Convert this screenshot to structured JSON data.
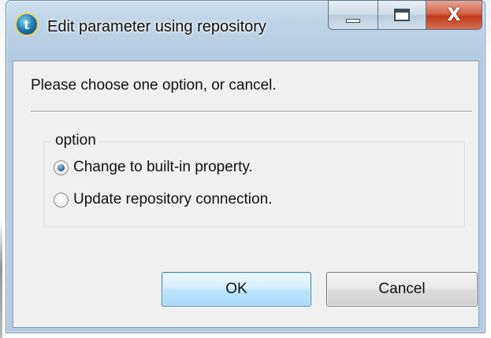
{
  "window": {
    "title": "Edit parameter using repository",
    "icon": "talend-app-icon",
    "icon_glyph": "t",
    "controls": {
      "minimize_icon": "minimize-icon",
      "maximize_icon": "maximize-icon",
      "close_icon": "close-icon",
      "close_glyph": "X"
    }
  },
  "dialog": {
    "prompt": "Please choose one option, or cancel.",
    "group": {
      "label": "option",
      "options": [
        {
          "label": "Change to built-in property.",
          "selected": true
        },
        {
          "label": "Update repository connection.",
          "selected": false
        }
      ]
    },
    "buttons": {
      "ok_label": "OK",
      "cancel_label": "Cancel",
      "default": "OK"
    }
  },
  "colors": {
    "selected_radio": "#1f5b9c",
    "ok_button_border": "#3c7fb1",
    "close_button": "#c2391c"
  }
}
